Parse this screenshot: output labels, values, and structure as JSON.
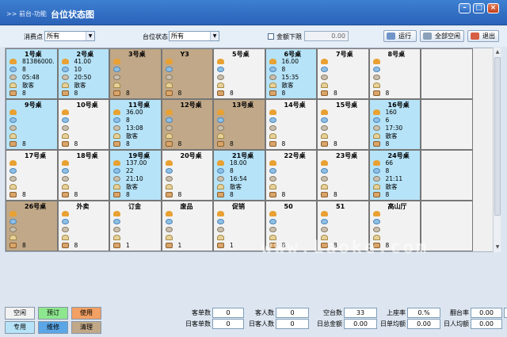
{
  "window": {
    "crumb": ">> 前台-功能",
    "title": "台位状态图"
  },
  "filters": {
    "point_label": "消费点",
    "point_value": "所有",
    "status_label": "台位状态",
    "status_value": "所有",
    "amount_limit_label": "金额下限",
    "amount_limit_value": "0.00"
  },
  "toolbar": {
    "run_label": "运行",
    "clear_all_label": "全部空闲",
    "exit_label": "退出"
  },
  "tables": [
    {
      "name": "1号桌",
      "state": "use",
      "lines": [
        "81386000.",
        "8",
        "05:48",
        "散客"
      ],
      "guests": "8"
    },
    {
      "name": "2号桌",
      "state": "use",
      "lines": [
        "41.00",
        "10",
        "20:50",
        "散客"
      ],
      "guests": "8"
    },
    {
      "name": "3号桌",
      "state": "clean",
      "lines": [],
      "guests": "8"
    },
    {
      "name": "Y3",
      "state": "clean",
      "lines": [],
      "guests": "8"
    },
    {
      "name": "5号桌",
      "state": "idle",
      "lines": [],
      "guests": "8"
    },
    {
      "name": "6号桌",
      "state": "use",
      "lines": [
        "16.00",
        "8",
        "15:35",
        "散客"
      ],
      "guests": "8"
    },
    {
      "name": "7号桌",
      "state": "idle",
      "lines": [],
      "guests": "8"
    },
    {
      "name": "8号桌",
      "state": "idle",
      "lines": [],
      "guests": "8"
    },
    {
      "name": "",
      "state": "idle",
      "lines": [],
      "guests": ""
    },
    {
      "name": "9号桌",
      "state": "use",
      "lines": [],
      "guests": "8"
    },
    {
      "name": "10号桌",
      "state": "idle",
      "lines": [],
      "guests": "8"
    },
    {
      "name": "11号桌",
      "state": "use",
      "lines": [
        "36.00",
        "8",
        "13:08",
        "散客"
      ],
      "guests": "8"
    },
    {
      "name": "12号桌",
      "state": "clean",
      "lines": [],
      "guests": "8"
    },
    {
      "name": "13号桌",
      "state": "clean",
      "lines": [],
      "guests": "8"
    },
    {
      "name": "14号桌",
      "state": "idle",
      "lines": [],
      "guests": "8"
    },
    {
      "name": "15号桌",
      "state": "idle",
      "lines": [],
      "guests": "8"
    },
    {
      "name": "16号桌",
      "state": "use",
      "lines": [
        "160",
        "6",
        "17:30",
        "散客"
      ],
      "guests": "8"
    },
    {
      "name": "",
      "state": "idle",
      "lines": [],
      "guests": ""
    },
    {
      "name": "17号桌",
      "state": "idle",
      "lines": [],
      "guests": "8"
    },
    {
      "name": "18号桌",
      "state": "idle",
      "lines": [],
      "guests": "8"
    },
    {
      "name": "19号桌",
      "state": "use",
      "lines": [
        "137.00",
        "22",
        "21:10",
        "散客"
      ],
      "guests": "8"
    },
    {
      "name": "20号桌",
      "state": "idle",
      "lines": [],
      "guests": "8"
    },
    {
      "name": "21号桌",
      "state": "use",
      "lines": [
        "18.00",
        "8",
        "16:54",
        "散客"
      ],
      "guests": "8"
    },
    {
      "name": "22号桌",
      "state": "idle",
      "lines": [],
      "guests": "8"
    },
    {
      "name": "23号桌",
      "state": "idle",
      "lines": [],
      "guests": "8"
    },
    {
      "name": "24号桌",
      "state": "use",
      "lines": [
        "66",
        "8",
        "21:11",
        "散客"
      ],
      "guests": "8"
    },
    {
      "name": "",
      "state": "idle",
      "lines": [],
      "guests": ""
    },
    {
      "name": "26号桌",
      "state": "clean",
      "lines": [],
      "guests": "8"
    },
    {
      "name": "外卖",
      "state": "idle",
      "lines": [],
      "guests": "8"
    },
    {
      "name": "订金",
      "state": "idle",
      "lines": [],
      "guests": "1"
    },
    {
      "name": "废品",
      "state": "idle",
      "lines": [],
      "guests": "1"
    },
    {
      "name": "促销",
      "state": "idle",
      "lines": [],
      "guests": "1"
    },
    {
      "name": "50",
      "state": "idle",
      "lines": [],
      "guests": "8"
    },
    {
      "name": "51",
      "state": "idle",
      "lines": [],
      "guests": "8"
    },
    {
      "name": "高山厅",
      "state": "idle",
      "lines": [],
      "guests": "8"
    },
    {
      "name": "",
      "state": "idle",
      "lines": [],
      "guests": ""
    }
  ],
  "legend": [
    {
      "label": "空闲",
      "color": "#f2f2f2"
    },
    {
      "label": "预订",
      "color": "#8ee68e"
    },
    {
      "label": "使用",
      "color": "#f2a063"
    },
    {
      "label": "专用",
      "color": "#b6e3f8"
    },
    {
      "label": "维修",
      "color": "#5aa6e6"
    },
    {
      "label": "清理",
      "color": "#c0a888"
    }
  ],
  "stats": {
    "r1": [
      {
        "label": "客单数",
        "value": "0"
      },
      {
        "label": "客人数",
        "value": "0"
      },
      {
        "label": "空台数",
        "value": "33"
      },
      {
        "label": "上座率",
        "value": "0.%"
      },
      {
        "label": "翻台率",
        "value": "0.00",
        "extra": "33"
      }
    ],
    "r2": [
      {
        "label": "日客单数",
        "value": "0"
      },
      {
        "label": "日客人数",
        "value": "0"
      },
      {
        "label": "日总金额",
        "value": "0.00"
      },
      {
        "label": "日单均额",
        "value": "0.00"
      },
      {
        "label": "日人均额",
        "value": "0.00"
      }
    ]
  },
  "watermark": "www.Laoke.com",
  "colors": {
    "title_bar": "#2a63b8",
    "in_use": "#b6e3f8",
    "cleaning": "#c0a888",
    "idle": "#f2f2f2"
  }
}
